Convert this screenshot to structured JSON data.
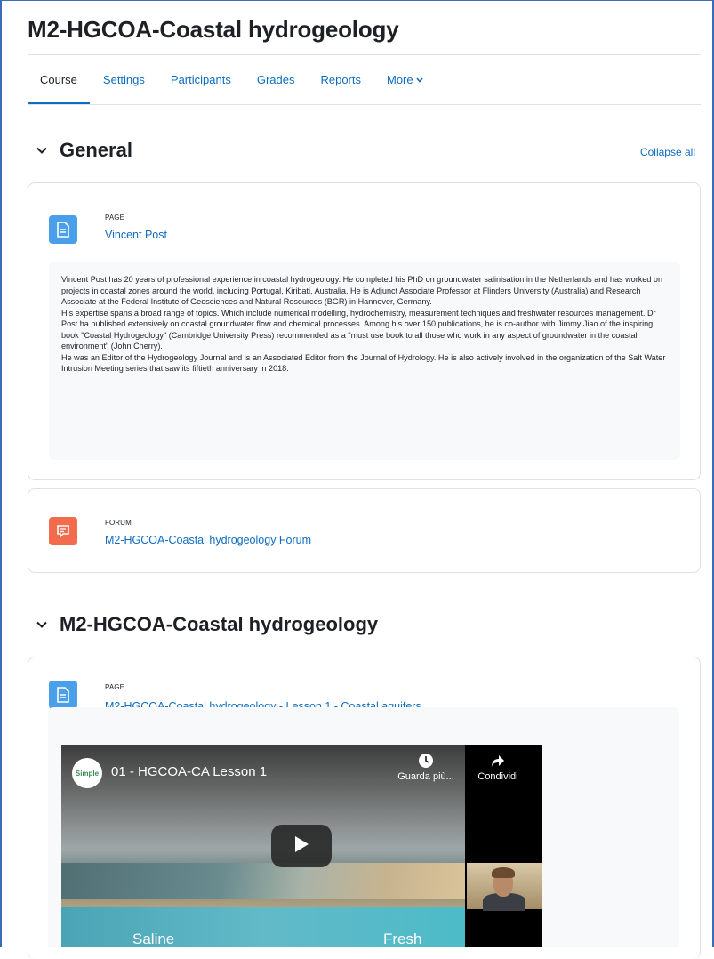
{
  "course": {
    "title": "M2-HGCOA-Coastal hydrogeology"
  },
  "tabs": [
    {
      "label": "Course",
      "active": true
    },
    {
      "label": "Settings"
    },
    {
      "label": "Participants"
    },
    {
      "label": "Grades"
    },
    {
      "label": "Reports"
    },
    {
      "label": "More"
    }
  ],
  "collapse_all": "Collapse all",
  "sections": [
    {
      "title": "General",
      "activities": [
        {
          "type": "PAGE",
          "icon": "page-icon",
          "name": "Vincent Post",
          "description": [
            "Vincent Post has 20 years of professional experience in coastal hydrogeology. He completed his PhD on groundwater salinisation in the Netherlands and has worked on projects in coastal zones around the world, including Portugal, Kiribati, Australia. He is Adjunct Associate Professor at Flinders University (Australia) and Research Associate at the Federal Institute of Geosciences and Natural Resources (BGR) in Hannover, Germany.",
            "His expertise spans a broad range of topics. Which include numerical modelling, hydrochemistry, measurement techniques and freshwater resources management. Dr Post ha published extensively on coastal groundwater flow and chemical processes. Among his over 150 publications, he is co-author with Jimmy Jiao of the inspiring book \"Coastal Hydrogeology\" (Cambridge University Press) recommended as a \"must use book to all those who work in any aspect of groundwater in the coastal environment\" (John Cherry).",
            "He was an Editor of the Hydrogeology Journal and is an Associated Editor from the Journal of Hydrology. He is also actively involved in the organization of the Salt Water Intrusion Meeting series that saw its fiftieth anniversary in 2018."
          ]
        },
        {
          "type": "FORUM",
          "icon": "forum-icon",
          "name": "M2-HGCOA-Coastal hydrogeology Forum"
        }
      ]
    },
    {
      "title": "M2-HGCOA-Coastal hydrogeology",
      "activities": [
        {
          "type": "PAGE",
          "icon": "page-icon",
          "name": "M2-HGCOA-Coastal hydrogeology - Lesson 1 - Coastal aquifers",
          "video": {
            "channel_logo_text": "Simple",
            "title": "01 - HGCOA-CA Lesson 1",
            "watch_later": "Guarda più...",
            "share": "Condividi",
            "overlay_left": "Saline",
            "overlay_right": "Fresh"
          }
        }
      ]
    }
  ],
  "colors": {
    "link": "#0f6cbf",
    "page_icon_bg": "#4a9fea",
    "forum_icon_bg": "#f16b4c"
  }
}
